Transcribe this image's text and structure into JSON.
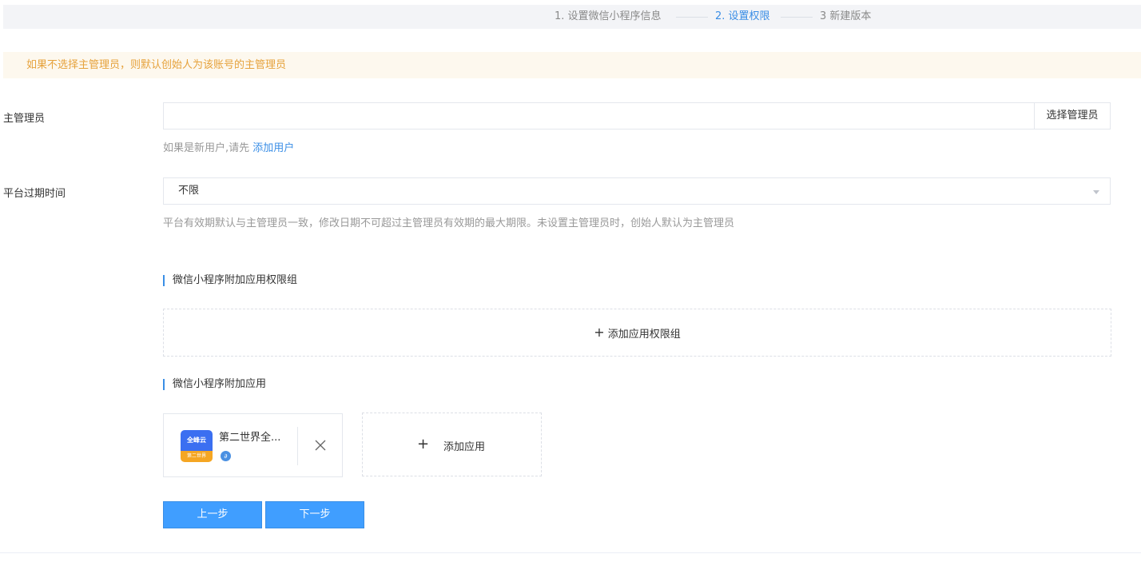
{
  "steps": {
    "step1": "1. 设置微信小程序信息",
    "step2": "2. 设置权限",
    "step3": "3 新建版本"
  },
  "warning": {
    "text": "如果不选择主管理员，则默认创始人为该账号的主管理员"
  },
  "form": {
    "admin_label": "主管理员",
    "admin_value": "",
    "select_admin_button": "选择管理员",
    "admin_hint_prefix": "如果是新用户,请先",
    "admin_hint_link": "添加用户",
    "expire_label": "平台过期时间",
    "expire_value": "不限",
    "expire_hint": "平台有效期默认与主管理员一致，修改日期不可超过主管理员有效期的最大期限。未设置主管理员时，创始人默认为主管理员"
  },
  "permission_groups": {
    "title": "微信小程序附加应用权限组",
    "add_label": "添加应用权限组"
  },
  "apps": {
    "title": "微信小程序附加应用",
    "items": [
      {
        "name": "第二世界全...",
        "logo_top": "全峰云",
        "logo_bottom": "第二世界"
      }
    ],
    "add_label": "添加应用"
  },
  "actions": {
    "prev": "上一步",
    "next": "下一步"
  },
  "colors": {
    "primary": "#409eff",
    "active_step": "#3a8ee6",
    "warning_text": "#e6a23c",
    "warning_bg": "#fdf8ee"
  }
}
